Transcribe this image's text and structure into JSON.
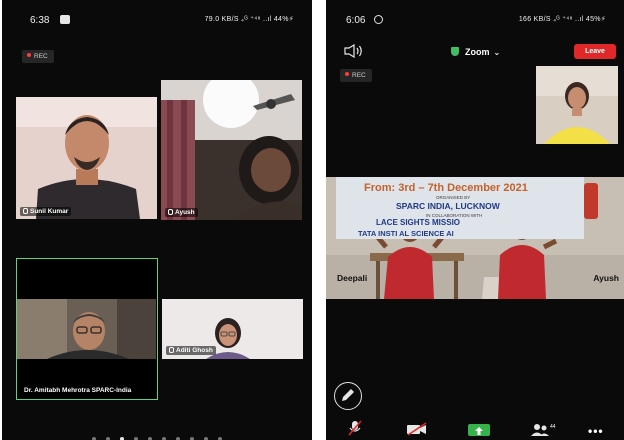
{
  "left_phone": {
    "status": {
      "time": "6:38",
      "system": "79.0 KB/S ₄ᴳ ⁺⁴⁸ ..ıl 44%⚡"
    },
    "rec_label": "REC",
    "tiles": {
      "sunil": {
        "name": "Sunil Kumar"
      },
      "ayush": {
        "name": "Ayush"
      },
      "amitabh": {
        "name": "Dr. Amitabh Mehrotra SPARC-India"
      },
      "aditi": {
        "name": "Aditi Ghosh"
      }
    },
    "page_count": 10,
    "active_page": 3
  },
  "right_phone": {
    "status": {
      "time": "6:06",
      "system": "166 KB/S ₄ᴳ ⁺⁴⁸ ..ıl 45%⚡"
    },
    "meeting_title": "Zoom",
    "leave_label": "Leave",
    "rec_label": "REC",
    "banner": {
      "date_line": "From: 3rd – 7th December 2021",
      "organized_by": "ORGANISED BY",
      "org_name": "SPARC INDIA, LUCKNOW",
      "collab": "IN COLLABORATION WITH",
      "partner_1": "LACE    SIGHTS MISSIO",
      "partner_2": "TATA INSTI        AL SCIENCE     AI"
    },
    "kid_labels": {
      "left": "Deepali",
      "right": "Ayush"
    },
    "participant_count": "44"
  },
  "colors": {
    "background": "#0a0a0a",
    "active_speaker_border": "#62d17a",
    "leave": "#e02828",
    "share": "#35b34a",
    "shield": "#3fbf62"
  }
}
